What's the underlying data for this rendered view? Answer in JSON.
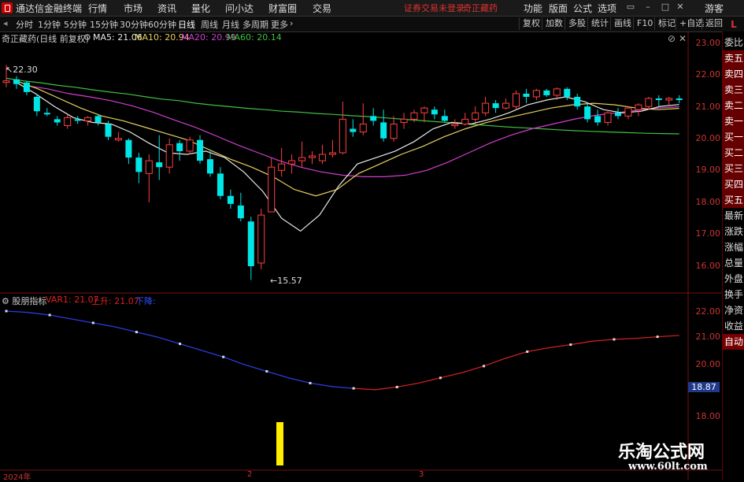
{
  "menubar": {
    "app_title": "通达信金融终端",
    "items": [
      "行情",
      "市场",
      "资讯",
      "量化",
      "问小达",
      "财富圈",
      "交易"
    ],
    "notice": "证券交易未登录",
    "stock_name": "奇正藏药",
    "right_items": [
      "功能",
      "版面",
      "公式",
      "选项"
    ],
    "user": "游客"
  },
  "periodbar": {
    "periods": [
      "分时",
      "1分钟",
      "5分钟",
      "15分钟",
      "30分钟",
      "60分钟",
      "日线",
      "周线",
      "月线",
      "多周期",
      "更多"
    ],
    "active": "日线",
    "tools": [
      "复权",
      "加数",
      "多股",
      "统计",
      "画线",
      "F10",
      "标记",
      "+自选",
      "返回"
    ]
  },
  "right_panel": {
    "corner": "L",
    "items": [
      "委比",
      "卖五",
      "卖四",
      "卖三",
      "卖二",
      "卖一",
      "买一",
      "买二",
      "买三",
      "买四",
      "买五",
      "最新",
      "涨跌",
      "涨幅",
      "总量",
      "外盘",
      "换手",
      "净资",
      "收益"
    ],
    "auto": "自动"
  },
  "main_chart": {
    "title": "奇正藏药(日线 前复权)",
    "ma": [
      {
        "label": "MA5: 21.06",
        "color": "#e8e8e8"
      },
      {
        "label": "MA10: 20.94",
        "color": "#e8d060"
      },
      {
        "label": "MA20: 20.99",
        "color": "#d040d0"
      },
      {
        "label": "MA60: 20.14",
        "color": "#40c040"
      }
    ],
    "high_label": "22.30",
    "low_label": "15.57",
    "y_ticks": [
      "23.00",
      "22.00",
      "21.00",
      "20.00",
      "19.00",
      "18.00",
      "17.00",
      "16.00"
    ]
  },
  "sub_chart": {
    "title": "股朋指标",
    "var1": "VAR1: 21.07",
    "up": "上升: 21.07",
    "down": "下降:",
    "y_ticks": [
      "22.00",
      "21.00",
      "20.00",
      "18.00"
    ],
    "last_value": "18.87"
  },
  "x_axis": {
    "labels": [
      "2024年",
      "2",
      "3"
    ]
  },
  "watermark": {
    "cn": "乐淘公式网",
    "url": "www.60lt.com"
  },
  "colors": {
    "up": "#ff4040",
    "down": "#00e5e5",
    "ma5": "#e8e8e8",
    "ma10": "#e8d060",
    "ma20": "#d040d0",
    "ma60": "#40c040"
  },
  "chart_data": {
    "type": "candlestick",
    "ylim": [
      15.2,
      23.3
    ],
    "candles": [
      {
        "o": 21.75,
        "h": 22.3,
        "l": 21.6,
        "c": 21.8
      },
      {
        "o": 21.85,
        "h": 21.95,
        "l": 21.55,
        "c": 21.7
      },
      {
        "o": 21.75,
        "h": 21.8,
        "l": 21.35,
        "c": 21.45
      },
      {
        "o": 21.3,
        "h": 21.4,
        "l": 20.7,
        "c": 20.85
      },
      {
        "o": 20.8,
        "h": 20.95,
        "l": 20.7,
        "c": 20.75
      },
      {
        "o": 20.6,
        "h": 20.7,
        "l": 20.4,
        "c": 20.5
      },
      {
        "o": 20.4,
        "h": 20.75,
        "l": 20.3,
        "c": 20.65
      },
      {
        "o": 20.6,
        "h": 20.7,
        "l": 20.45,
        "c": 20.55
      },
      {
        "o": 20.55,
        "h": 20.7,
        "l": 20.4,
        "c": 20.65
      },
      {
        "o": 20.7,
        "h": 20.75,
        "l": 20.4,
        "c": 20.5
      },
      {
        "o": 20.45,
        "h": 20.55,
        "l": 19.95,
        "c": 20.05
      },
      {
        "o": 19.95,
        "h": 20.2,
        "l": 19.9,
        "c": 20.0
      },
      {
        "o": 19.95,
        "h": 20.0,
        "l": 19.2,
        "c": 19.4
      },
      {
        "o": 19.4,
        "h": 19.55,
        "l": 18.6,
        "c": 18.95
      },
      {
        "o": 18.9,
        "h": 19.5,
        "l": 18.0,
        "c": 19.3
      },
      {
        "o": 19.25,
        "h": 20.1,
        "l": 18.7,
        "c": 19.1
      },
      {
        "o": 19.1,
        "h": 20.0,
        "l": 18.9,
        "c": 19.8
      },
      {
        "o": 19.85,
        "h": 19.95,
        "l": 19.3,
        "c": 19.6
      },
      {
        "o": 19.6,
        "h": 20.05,
        "l": 19.5,
        "c": 19.95
      },
      {
        "o": 19.95,
        "h": 20.1,
        "l": 19.2,
        "c": 19.3
      },
      {
        "o": 19.35,
        "h": 19.6,
        "l": 18.8,
        "c": 18.9
      },
      {
        "o": 18.9,
        "h": 19.1,
        "l": 18.1,
        "c": 18.2
      },
      {
        "o": 18.2,
        "h": 18.4,
        "l": 17.8,
        "c": 17.95
      },
      {
        "o": 17.9,
        "h": 18.3,
        "l": 17.4,
        "c": 17.5
      },
      {
        "o": 17.4,
        "h": 17.55,
        "l": 15.57,
        "c": 16.0
      },
      {
        "o": 16.1,
        "h": 17.8,
        "l": 15.9,
        "c": 17.6
      },
      {
        "o": 17.7,
        "h": 19.4,
        "l": 17.7,
        "c": 19.1
      },
      {
        "o": 19.0,
        "h": 19.7,
        "l": 18.8,
        "c": 19.2
      },
      {
        "o": 19.2,
        "h": 19.5,
        "l": 18.9,
        "c": 19.3
      },
      {
        "o": 19.3,
        "h": 19.9,
        "l": 19.1,
        "c": 19.4
      },
      {
        "o": 19.4,
        "h": 19.6,
        "l": 19.2,
        "c": 19.45
      },
      {
        "o": 19.3,
        "h": 19.8,
        "l": 19.2,
        "c": 19.5
      },
      {
        "o": 19.5,
        "h": 19.95,
        "l": 19.4,
        "c": 19.55
      },
      {
        "o": 19.55,
        "h": 21.15,
        "l": 19.5,
        "c": 20.6
      },
      {
        "o": 20.3,
        "h": 20.6,
        "l": 20.05,
        "c": 20.2
      },
      {
        "o": 20.2,
        "h": 21.1,
        "l": 20.1,
        "c": 20.45
      },
      {
        "o": 20.7,
        "h": 20.95,
        "l": 20.4,
        "c": 20.55
      },
      {
        "o": 20.5,
        "h": 20.9,
        "l": 19.9,
        "c": 20.0
      },
      {
        "o": 20.0,
        "h": 20.7,
        "l": 19.9,
        "c": 20.45
      },
      {
        "o": 20.5,
        "h": 20.8,
        "l": 20.3,
        "c": 20.6
      },
      {
        "o": 20.6,
        "h": 20.9,
        "l": 20.5,
        "c": 20.8
      },
      {
        "o": 20.8,
        "h": 21.0,
        "l": 20.5,
        "c": 20.95
      },
      {
        "o": 20.9,
        "h": 21.0,
        "l": 20.6,
        "c": 20.75
      },
      {
        "o": 20.7,
        "h": 20.9,
        "l": 20.5,
        "c": 20.55
      },
      {
        "o": 20.4,
        "h": 20.6,
        "l": 20.3,
        "c": 20.45
      },
      {
        "o": 20.45,
        "h": 20.8,
        "l": 20.4,
        "c": 20.6
      },
      {
        "o": 20.6,
        "h": 21.0,
        "l": 20.5,
        "c": 20.8
      },
      {
        "o": 20.8,
        "h": 21.3,
        "l": 20.7,
        "c": 21.1
      },
      {
        "o": 21.1,
        "h": 21.2,
        "l": 20.8,
        "c": 20.95
      },
      {
        "o": 20.95,
        "h": 21.25,
        "l": 20.9,
        "c": 21.1
      },
      {
        "o": 21.0,
        "h": 21.5,
        "l": 20.9,
        "c": 21.4
      },
      {
        "o": 21.4,
        "h": 21.55,
        "l": 21.1,
        "c": 21.3
      },
      {
        "o": 21.3,
        "h": 21.55,
        "l": 21.2,
        "c": 21.5
      },
      {
        "o": 21.5,
        "h": 21.55,
        "l": 21.3,
        "c": 21.35
      },
      {
        "o": 21.35,
        "h": 21.6,
        "l": 21.2,
        "c": 21.55
      },
      {
        "o": 21.55,
        "h": 21.6,
        "l": 21.2,
        "c": 21.3
      },
      {
        "o": 21.3,
        "h": 21.4,
        "l": 20.9,
        "c": 21.0
      },
      {
        "o": 21.0,
        "h": 21.1,
        "l": 20.5,
        "c": 20.6
      },
      {
        "o": 20.7,
        "h": 20.9,
        "l": 20.4,
        "c": 20.5
      },
      {
        "o": 20.5,
        "h": 20.9,
        "l": 20.4,
        "c": 20.8
      },
      {
        "o": 20.8,
        "h": 20.95,
        "l": 20.6,
        "c": 20.7
      },
      {
        "o": 20.7,
        "h": 21.0,
        "l": 20.6,
        "c": 20.95
      },
      {
        "o": 20.9,
        "h": 21.1,
        "l": 20.7,
        "c": 21.05
      },
      {
        "o": 21.0,
        "h": 21.3,
        "l": 20.9,
        "c": 21.25
      },
      {
        "o": 21.25,
        "h": 21.35,
        "l": 21.0,
        "c": 21.2
      },
      {
        "o": 21.2,
        "h": 21.3,
        "l": 21.05,
        "c": 21.25
      },
      {
        "o": 21.25,
        "h": 21.35,
        "l": 21.1,
        "c": 21.2
      }
    ],
    "ma60": [
      21.88,
      21.8,
      21.74,
      21.66,
      21.6,
      21.52,
      21.45,
      21.39,
      21.31,
      21.23,
      21.18,
      21.1,
      21.04,
      20.99,
      20.94,
      20.9,
      20.85,
      20.82,
      20.78,
      20.75,
      20.71,
      20.68,
      20.64,
      20.6,
      20.56,
      20.52,
      20.48,
      20.44,
      20.4,
      20.36,
      20.33,
      20.3,
      20.27,
      20.24,
      20.22,
      20.2,
      20.18,
      20.16,
      20.15,
      20.14
    ],
    "ma20": [
      21.65,
      21.55,
      21.4,
      21.3,
      21.18,
      21.02,
      20.82,
      20.58,
      20.35,
      20.08,
      19.8,
      19.55,
      19.3,
      19.1,
      18.95,
      18.85,
      18.8,
      18.8,
      18.85,
      19.0,
      19.25,
      19.55,
      19.85,
      20.1,
      20.3,
      20.45,
      20.6,
      20.72,
      20.8,
      20.88,
      20.95,
      20.99
    ],
    "ma10": [
      21.8,
      21.55,
      21.25,
      20.95,
      20.7,
      20.55,
      20.35,
      20.15,
      19.95,
      19.65,
      19.35,
      19.1,
      18.8,
      18.4,
      18.2,
      18.4,
      18.9,
      19.2,
      19.5,
      19.75,
      20.05,
      20.3,
      20.5,
      20.65,
      20.8,
      20.95,
      21.05,
      21.1,
      21.05,
      20.95,
      20.9,
      20.94
    ],
    "ma5": [
      21.75,
      21.4,
      21.0,
      20.65,
      20.5,
      20.45,
      20.2,
      19.85,
      19.55,
      19.5,
      19.6,
      19.4,
      18.95,
      18.35,
      17.5,
      17.1,
      17.6,
      18.5,
      19.2,
      19.4,
      19.6,
      19.9,
      20.3,
      20.5,
      20.45,
      20.6,
      20.8,
      21.05,
      21.2,
      21.3,
      21.15,
      20.9,
      20.8,
      20.85,
      21.0,
      21.06
    ],
    "indicator": {
      "var1": [
        22.0,
        21.95,
        21.85,
        21.7,
        21.55,
        21.4,
        21.2,
        21.0,
        20.75,
        20.5,
        20.25,
        19.95,
        19.7,
        19.45,
        19.25,
        19.12,
        19.05,
        19.0,
        19.1,
        19.25,
        19.45,
        19.65,
        19.9,
        20.2,
        20.45,
        20.6,
        20.72,
        20.85,
        20.92,
        20.96,
        21.02,
        21.07
      ],
      "turn_index": 16,
      "last": 21.07
    },
    "yellow_bar_index": 12
  }
}
